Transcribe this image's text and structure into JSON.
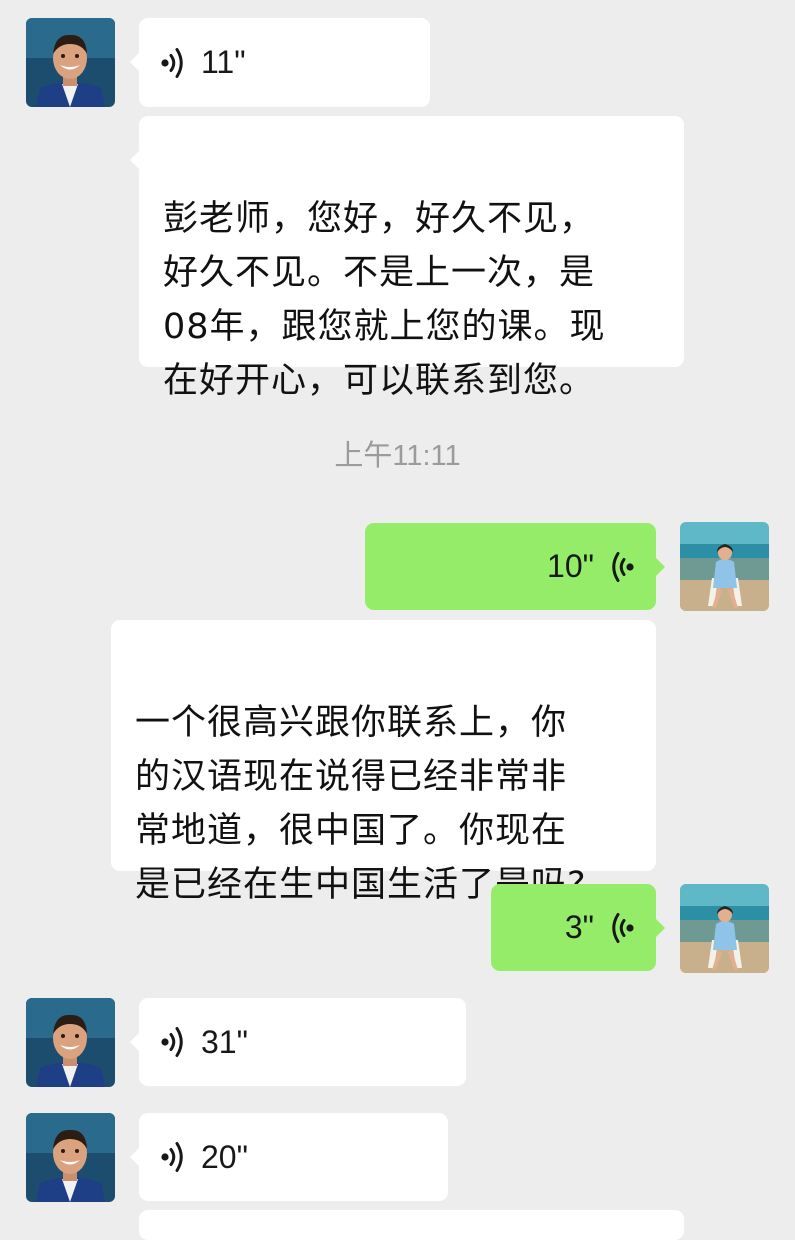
{
  "chat": {
    "timestamp": "上午11:11",
    "messages": [
      {
        "sender": "teacher",
        "type": "voice",
        "duration": "11\""
      },
      {
        "sender": "teacher",
        "type": "text",
        "text": "彭老师，您好，好久不见，\n好久不见。不是上一次，是\n08年，跟您就上您的课。现\n在好开心，可以联系到您。"
      },
      {
        "sender": "me",
        "type": "voice",
        "duration": "10\""
      },
      {
        "sender": "me",
        "type": "text",
        "text": "一个很高兴跟你联系上，你\n的汉语现在说得已经非常非\n常地道，很中国了。你现在\n是已经在生中国生活了是吗?"
      },
      {
        "sender": "me",
        "type": "voice",
        "duration": "3\""
      },
      {
        "sender": "teacher",
        "type": "voice",
        "duration": "31\""
      },
      {
        "sender": "teacher",
        "type": "voice",
        "duration": "20\""
      }
    ]
  },
  "colors": {
    "background": "#ededed",
    "incoming_bubble": "#ffffff",
    "outgoing_bubble": "#95ec69",
    "timestamp_text": "#9b9b9b"
  },
  "icons": {
    "voice_incoming": "voice-wave-right-icon",
    "voice_outgoing": "voice-wave-left-icon"
  }
}
